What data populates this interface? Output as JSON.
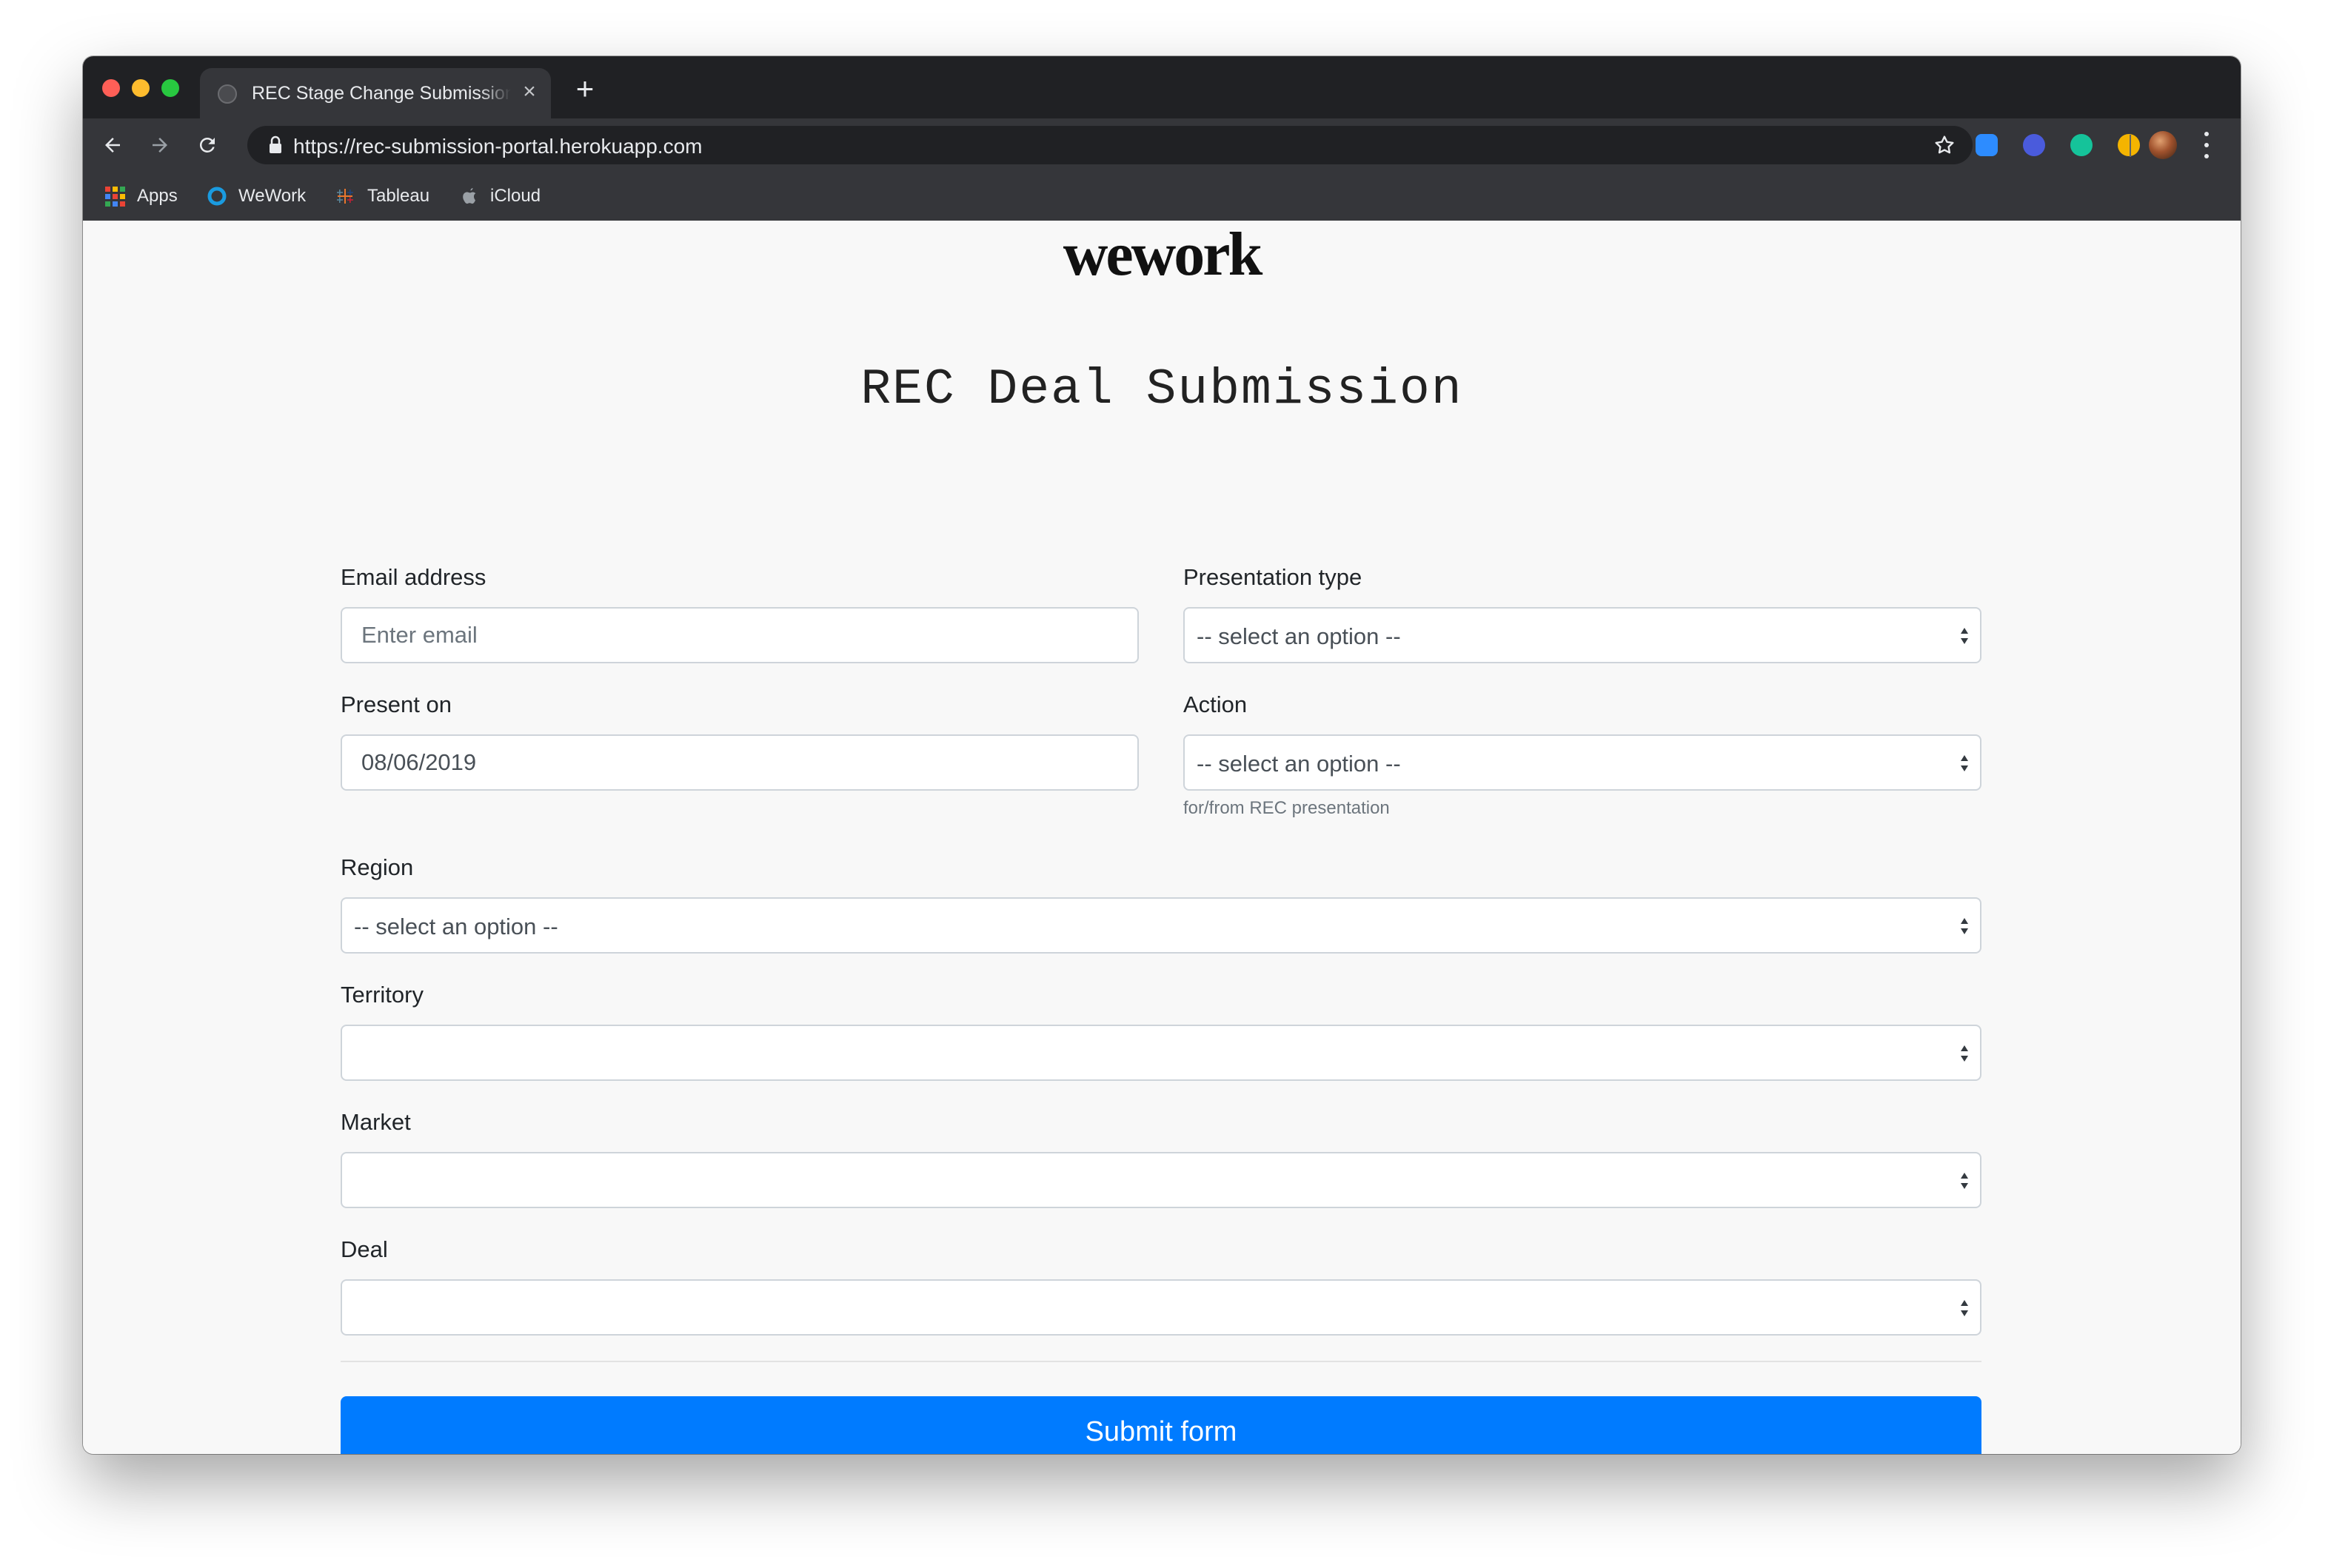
{
  "browser": {
    "tab_title": "REC Stage Change Submission",
    "tab_close": "×",
    "new_tab": "+",
    "url": "https://rec-submission-portal.herokuapp.com",
    "bookmarks": [
      {
        "label": "Apps",
        "icon": "apps-grid-icon"
      },
      {
        "label": "WeWork",
        "icon": "wework-icon"
      },
      {
        "label": "Tableau",
        "icon": "tableau-icon"
      },
      {
        "label": "iCloud",
        "icon": "apple-icon"
      }
    ],
    "extensions": [
      {
        "icon": "zoom-extension-icon",
        "color": "#2d8cff"
      },
      {
        "icon": "extension-check-icon",
        "color": "#4a5bdc"
      },
      {
        "icon": "grammarly-icon",
        "color": "#15c39a"
      },
      {
        "icon": "extension-compass-icon",
        "color": "#f4b400"
      },
      {
        "icon": "extension-puzzle-icon",
        "color": "#9aa0a6"
      }
    ]
  },
  "page": {
    "logo": "wework",
    "title": "REC Deal Submission"
  },
  "form": {
    "email": {
      "label": "Email address",
      "placeholder": "Enter email",
      "value": ""
    },
    "presentation_type": {
      "label": "Presentation type",
      "value": "-- select an option --"
    },
    "present_on": {
      "label": "Present on",
      "value": "08/06/2019"
    },
    "action": {
      "label": "Action",
      "value": "-- select an option --",
      "help": "for/from REC presentation"
    },
    "region": {
      "label": "Region",
      "value": "-- select an option --"
    },
    "territory": {
      "label": "Territory",
      "value": ""
    },
    "market": {
      "label": "Market",
      "value": ""
    },
    "deal": {
      "label": "Deal",
      "value": ""
    },
    "submit_label": "Submit form"
  },
  "colors": {
    "primary": "#007bff",
    "page_background": "#f8f8f8",
    "browser_chrome": "#35363a"
  }
}
